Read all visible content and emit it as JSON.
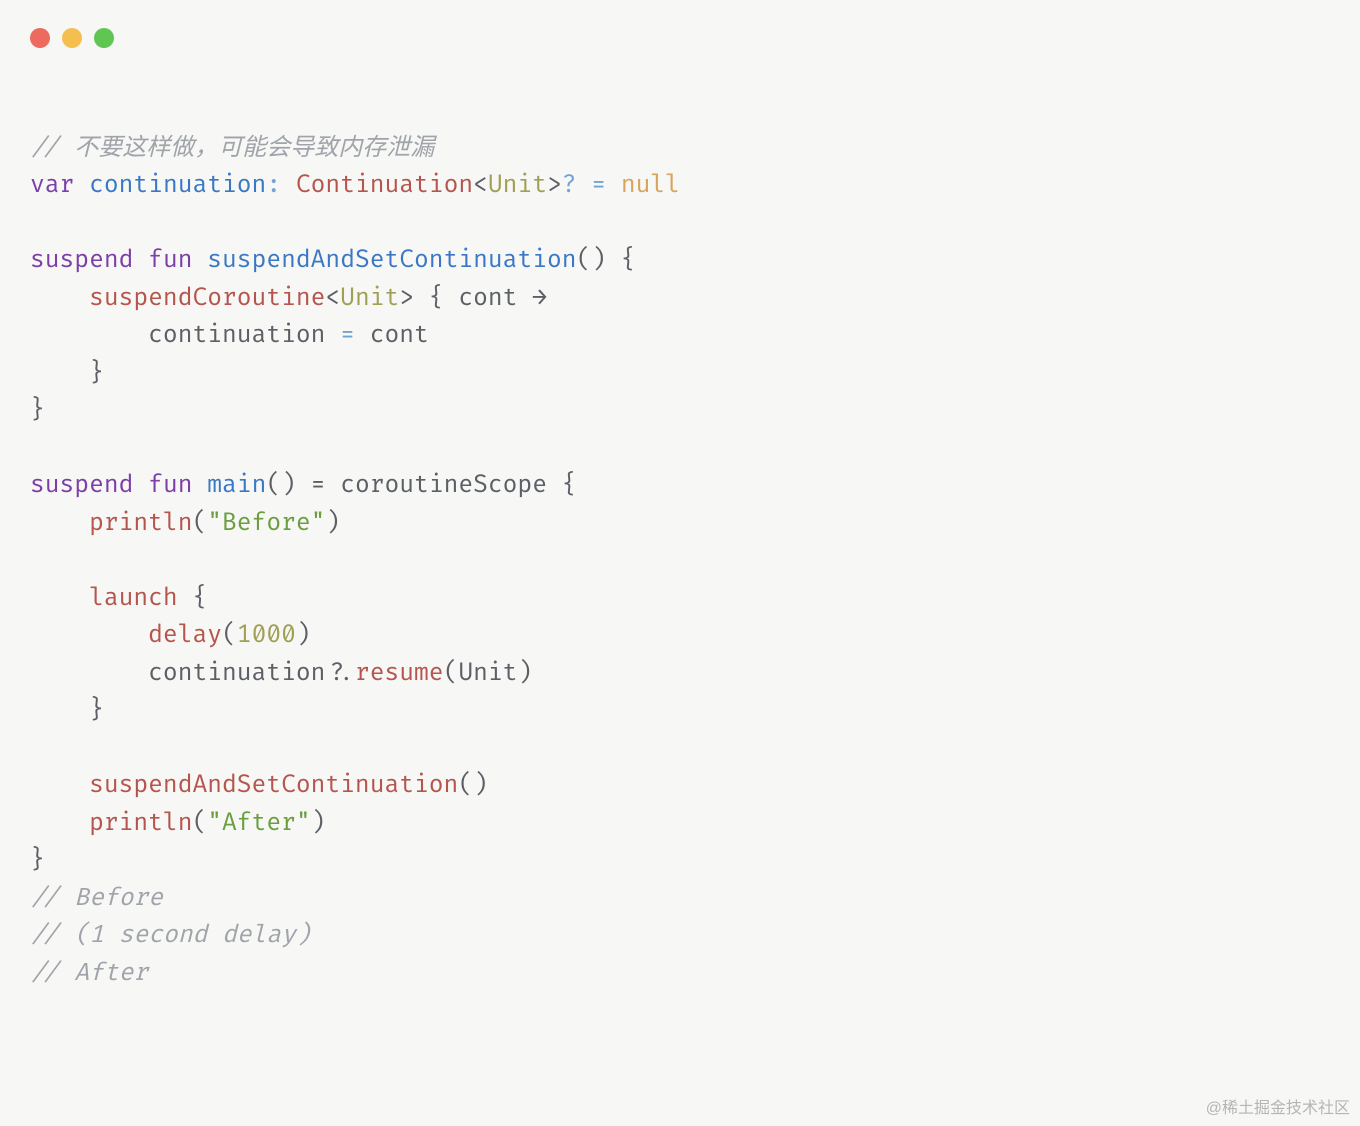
{
  "watermark": "@稀土掘金技术社区",
  "code": {
    "l1": {
      "comment": "// 不要这样做，可能会导致内存泄漏"
    },
    "l2": {
      "kw_var": "var",
      "sp": " ",
      "name": "continuation",
      "colon": ": ",
      "type": "Continuation",
      "lt": "<",
      "targ": "Unit",
      "gt": ">",
      "q": "?",
      "eq": " = ",
      "null": "null"
    },
    "l3": "",
    "l4": {
      "kw_s": "suspend",
      "sp1": " ",
      "kw_f": "fun",
      "sp2": " ",
      "name": "suspendAndSetContinuation",
      "after": "() {"
    },
    "l5": {
      "indent": "    ",
      "call": "suspendCoroutine",
      "lt": "<",
      "targ": "Unit",
      "gt": ">",
      "mid": " { ",
      "arg": "cont",
      "sp": " ",
      "arrow": "→"
    },
    "l6": {
      "indent": "        ",
      "name": "continuation",
      "eq": " = ",
      "val": "cont"
    },
    "l7": {
      "indent": "    ",
      "brace": "}"
    },
    "l8": {
      "brace": "}"
    },
    "l9": "",
    "l10": {
      "kw_s": "suspend",
      "sp1": " ",
      "kw_f": "fun",
      "sp2": " ",
      "name": "main",
      "after1": "() = ",
      "scope": "coroutineScope",
      "after2": " {"
    },
    "l11": {
      "indent": "    ",
      "fn": "println",
      "open": "(",
      "str": "\"Before\"",
      "close": ")"
    },
    "l12": "",
    "l13": {
      "indent": "    ",
      "fn": "launch",
      "after": " {"
    },
    "l14": {
      "indent": "        ",
      "fn": "delay",
      "open": "(",
      "num": "1000",
      "close": ")"
    },
    "l15": {
      "indent": "        ",
      "name": "continuation",
      "q": "?",
      "dot": ".",
      "fn": "resume",
      "open": "(",
      "arg": "Unit",
      "close": ")"
    },
    "l16": {
      "indent": "    ",
      "brace": "}"
    },
    "l17": "",
    "l18": {
      "indent": "    ",
      "fn": "suspendAndSetContinuation",
      "after": "()"
    },
    "l19": {
      "indent": "    ",
      "fn": "println",
      "open": "(",
      "str": "\"After\"",
      "close": ")"
    },
    "l20": {
      "brace": "}"
    },
    "l21": {
      "comment": "// Before"
    },
    "l22": {
      "comment": "// (1 second delay)"
    },
    "l23": {
      "comment": "// After"
    }
  }
}
